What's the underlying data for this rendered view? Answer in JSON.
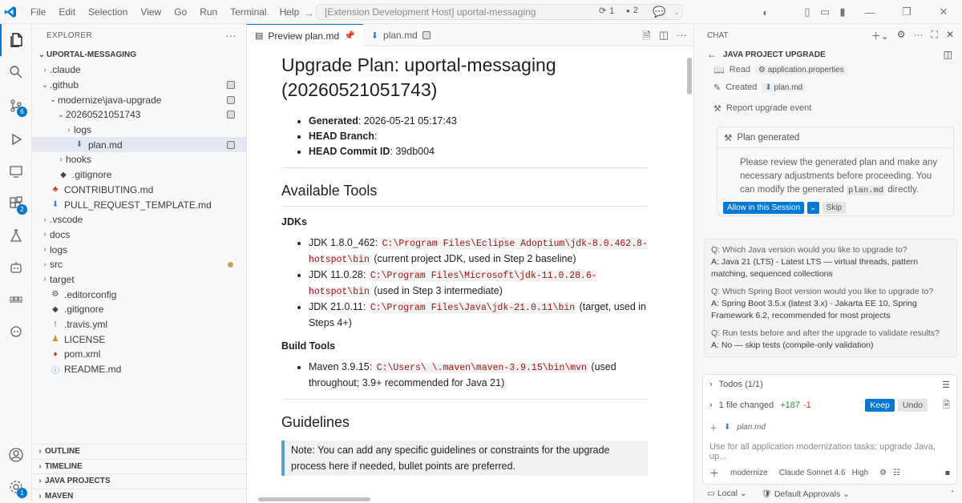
{
  "titlebar": {
    "menu": [
      "File",
      "Edit",
      "Selection",
      "View",
      "Go",
      "Run",
      "Terminal",
      "Help"
    ],
    "search_text": "[Extension Development Host] uportal-messaging",
    "sync_count": "1",
    "problems_count": "2"
  },
  "activity": {
    "scm_badge": "6",
    "ext_badge": "2",
    "accounts_badge": "1"
  },
  "explorer": {
    "title": "EXPLORER",
    "root": "UPORTAL-MESSAGING",
    "items": [
      {
        "label": ".claude",
        "indent": 0,
        "kind": "folder",
        "open": false
      },
      {
        "label": ".github",
        "indent": 0,
        "kind": "folder",
        "open": true,
        "mark": true
      },
      {
        "label": "modernize\\java-upgrade",
        "indent": 1,
        "kind": "folder",
        "open": true,
        "mark": true
      },
      {
        "label": "20260521051743",
        "indent": 2,
        "kind": "folder",
        "open": true,
        "mark": true
      },
      {
        "label": "logs",
        "indent": 3,
        "kind": "folder",
        "open": false
      },
      {
        "label": "plan.md",
        "indent": 3,
        "kind": "md",
        "selected": true,
        "mark": true
      },
      {
        "label": "hooks",
        "indent": 2,
        "kind": "folder",
        "open": false
      },
      {
        "label": ".gitignore",
        "indent": 1,
        "kind": "git"
      },
      {
        "label": "CONTRIBUTING.md",
        "indent": 0,
        "kind": "contrib"
      },
      {
        "label": "PULL_REQUEST_TEMPLATE.md",
        "indent": 0,
        "kind": "md"
      },
      {
        "label": ".vscode",
        "indent": 0,
        "kind": "folder",
        "open": false
      },
      {
        "label": "docs",
        "indent": 0,
        "kind": "folder",
        "open": false
      },
      {
        "label": "logs",
        "indent": 0,
        "kind": "folder",
        "open": false
      },
      {
        "label": "src",
        "indent": 0,
        "kind": "folder",
        "open": false,
        "dot": true
      },
      {
        "label": "target",
        "indent": 0,
        "kind": "folder",
        "open": false
      },
      {
        "label": ".editorconfig",
        "indent": 0,
        "kind": "gear"
      },
      {
        "label": ".gitignore",
        "indent": 0,
        "kind": "git"
      },
      {
        "label": ".travis.yml",
        "indent": 0,
        "kind": "yml"
      },
      {
        "label": "LICENSE",
        "indent": 0,
        "kind": "license"
      },
      {
        "label": "pom.xml",
        "indent": 0,
        "kind": "xml"
      },
      {
        "label": "README.md",
        "indent": 0,
        "kind": "info"
      }
    ],
    "bottom": [
      "OUTLINE",
      "TIMELINE",
      "JAVA PROJECTS",
      "MAVEN"
    ]
  },
  "editor": {
    "tabs": [
      {
        "label": "Preview plan.md"
      },
      {
        "label": "plan.md"
      }
    ],
    "doc": {
      "title": "Upgrade Plan: uportal-messaging (20260521051743)",
      "meta": [
        {
          "k": "Generated",
          "v": ": 2026-05-21 05:17:43"
        },
        {
          "k": "HEAD Branch",
          "v": ":"
        },
        {
          "k": "HEAD Commit ID",
          "v": ": 39db004"
        }
      ],
      "h_tools": "Available Tools",
      "h_jdks": "JDKs",
      "jdks": [
        {
          "pre": "JDK 1.8.0_462: ",
          "code": "C:\\Program Files\\Eclipse Adoptium\\jdk-8.0.462.8-hotspot\\bin",
          "post": " (current project JDK, used in Step 2 baseline)"
        },
        {
          "pre": "JDK 11.0.28: ",
          "code": "C:\\Program Files\\Microsoft\\jdk-11.0.28.6-hotspot\\bin",
          "post": " (used in Step 3 intermediate)"
        },
        {
          "pre": "JDK 21.0.11: ",
          "code": "C:\\Program Files\\Java\\jdk-21.0.11\\bin",
          "post": " (target, used in Steps 4+)"
        }
      ],
      "h_build": "Build Tools",
      "build": [
        {
          "pre": "Maven 3.9.15: ",
          "code": "C:\\Users\\      \\.maven\\maven-3.9.15\\bin\\mvn",
          "post": " (used throughout; 3.9+ recommended for Java 21)"
        }
      ],
      "h_guide": "Guidelines",
      "note": "Note: You can add any specific guidelines or constraints for the upgrade process here if needed, bullet points are preferred."
    }
  },
  "chat": {
    "title": "CHAT",
    "subtitle": "JAVA PROJECT UPGRADE",
    "read_label": "Read",
    "read_file": "application.properties",
    "created_label": "Created",
    "created_file": "plan.md",
    "report": "Report upgrade event",
    "plan_head": "Plan generated",
    "plan_body_1": "Please review the generated plan and make any necessary adjustments before proceeding. You can modify the generated ",
    "plan_code": "plan.md",
    "plan_body_2": " directly.",
    "allow": "Allow in this Session",
    "skip": "Skip",
    "qa": [
      {
        "q": "Q: Which Java version would you like to upgrade to?",
        "a": "A: Java 21 (LTS) - Latest LTS — virtual threads, pattern matching, sequenced collections"
      },
      {
        "q": "Q: Which Spring Boot version would you like to upgrade to?",
        "a": "A: Spring Boot 3.5.x (latest 3.x) - Jakarta EE 10, Spring Framework 6.2, recommended for most projects"
      },
      {
        "q": "Q: Run tests before and after the upgrade to validate results?",
        "a": "A: No — skip tests (compile-only validation)"
      }
    ],
    "todos": "Todos (1/1)",
    "files_changed": "1 file changed",
    "added": "+187",
    "removed": "-1",
    "keep": "Keep",
    "undo": "Undo",
    "changed_file": "plan.md",
    "placeholder": "Use for all application modernization tasks: upgrade Java, up...",
    "agent": "modernize",
    "model": "Claude Sonnet 4.6",
    "effort": "High",
    "local": "Local",
    "approvals": "Default Approvals"
  }
}
